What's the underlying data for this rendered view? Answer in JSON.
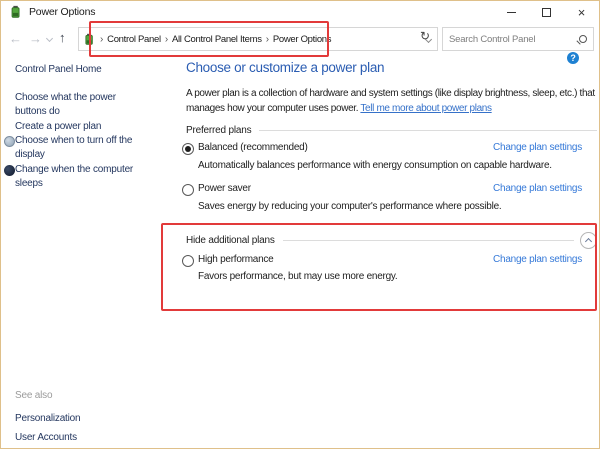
{
  "window": {
    "title": "Power Options"
  },
  "nav": {
    "breadcrumb": [
      "Control Panel",
      "All Control Panel Items",
      "Power Options"
    ],
    "search_placeholder": "Search Control Panel"
  },
  "icons": {
    "back": "←",
    "forward": "→",
    "up": "↑",
    "refresh": "↻",
    "close": "×",
    "help": "?",
    "crumb_sep": "›",
    "icon_sep": "›"
  },
  "sidebar": {
    "home": "Control Panel Home",
    "tasks": [
      {
        "label": "Choose what the power buttons do"
      },
      {
        "label": "Create a power plan"
      },
      {
        "label": "Choose when to turn off the display"
      },
      {
        "label": "Change when the computer sleeps"
      }
    ],
    "see_also": "See also",
    "see_also_links": [
      "Personalization",
      "User Accounts"
    ]
  },
  "main": {
    "heading": "Choose or customize a power plan",
    "intro": "A power plan is a collection of hardware and system settings (like display brightness, sleep, etc.) that manages how your computer uses power. ",
    "intro_link": "Tell me more about power plans",
    "sections": [
      {
        "title": "Preferred plans",
        "plans": [
          {
            "name": "Balanced (recommended)",
            "selected": true,
            "description": "Automatically balances performance with energy consumption on capable hardware.",
            "link": "Change plan settings"
          },
          {
            "name": "Power saver",
            "selected": false,
            "description": "Saves energy by reducing your computer's performance where possible.",
            "link": "Change plan settings"
          }
        ]
      },
      {
        "title": "Hide additional plans",
        "plans": [
          {
            "name": "High performance",
            "selected": false,
            "description": "Favors performance, but may use more energy.",
            "link": "Change plan settings"
          }
        ]
      }
    ]
  },
  "colors": {
    "accent_link": "#3579d8",
    "heading": "#2b5db2",
    "annotation": "#e23a3a"
  }
}
